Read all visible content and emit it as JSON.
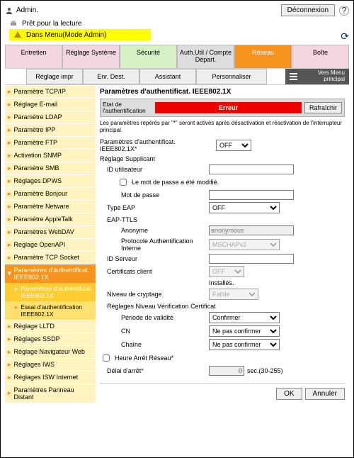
{
  "top": {
    "user": "Admin.",
    "logout": "Déconnexion",
    "ready": "Prêt pour la lecture",
    "mode": "Dans Menu(Mode Admin)"
  },
  "tabs": [
    "Entretien",
    "Réglage Système",
    "Sécurité",
    "Auth.Util / Compte Départ.",
    "Réseau",
    "Boîte"
  ],
  "tabs2": [
    "Réglage impr",
    "Enr. Dest.",
    "Assistant",
    "Personnaliser"
  ],
  "vers": "Vers Menu principal",
  "sidebar": [
    "Paramètre TCP/IP",
    "Réglage E-mail",
    "Paramètre LDAP",
    "Paramètre IPP",
    "Paramètre FTP",
    "Activation SNMP",
    "Paramètre SMB",
    "Réglages DPWS",
    "Paramètre Bonjour",
    "Paramètre Netware",
    "Paramètre AppleTalk",
    "Paramètres WebDAV",
    "Reglage OpenAPI",
    "Paramètre TCP Socket"
  ],
  "sidebar_active": "Paramètres d'authentificat. IEEE802.1X",
  "sidebar_sub1": "Paramètres d'authentificat. IEEE802.1X",
  "sidebar_sub2": "Essai d'authentification IEEE802.1X",
  "sidebar_after": [
    "Réglage LLTD",
    "Réglages SSDP",
    "Réglage Navigateur Web",
    "Réglages IWS",
    "Réglages ISW Internet",
    "Paramètres Panneau Distant"
  ],
  "content": {
    "title": "Paramètres d'authentificat. IEEE802.1X",
    "status_label": "Etat de l'authentification",
    "error": "Erreur",
    "refresh": "Rafraîchir",
    "note": "Les paramètres repérés par \"*\" seront activés après désactivation et réactivation de l'interrupteur principal.",
    "param_label": "Paramètres d'authentificat. IEEE802.1X*",
    "param_value": "OFF",
    "supplicant": "Réglage Supplicant",
    "id_user": "ID utilisateur",
    "pw_mod": "Le mot de passe a été modifié.",
    "pw": "Mot de passe",
    "eap_label": "Type EAP",
    "eap_value": "OFF",
    "eapttls": "EAP-TTLS",
    "anon": "Anonyme",
    "anon_ph": "anonymous",
    "proto": "Protocole Authentification Interne",
    "proto_val": "MSCHAPv2",
    "server": "ID Serveur",
    "cert": "Certificats client",
    "cert_val": "OFF",
    "installed": "Installés.",
    "crypt": "Niveau de cryptage",
    "crypt_val": "Faible",
    "vcert": "Réglages Niveau Vérification Certificat",
    "period": "Période de validité",
    "period_val": "Confirmer",
    "cn": "CN",
    "cn_val": "Ne pas confirmer",
    "chain": "Chaîne",
    "chain_val": "Ne pas confirmer",
    "timeout": "Heure Arrêt Réseau*",
    "delay": "Délai d'arrêt*",
    "delay_val": "0",
    "delay_unit": "sec.(30-255)"
  },
  "buttons": {
    "ok": "OK",
    "cancel": "Annuler"
  }
}
